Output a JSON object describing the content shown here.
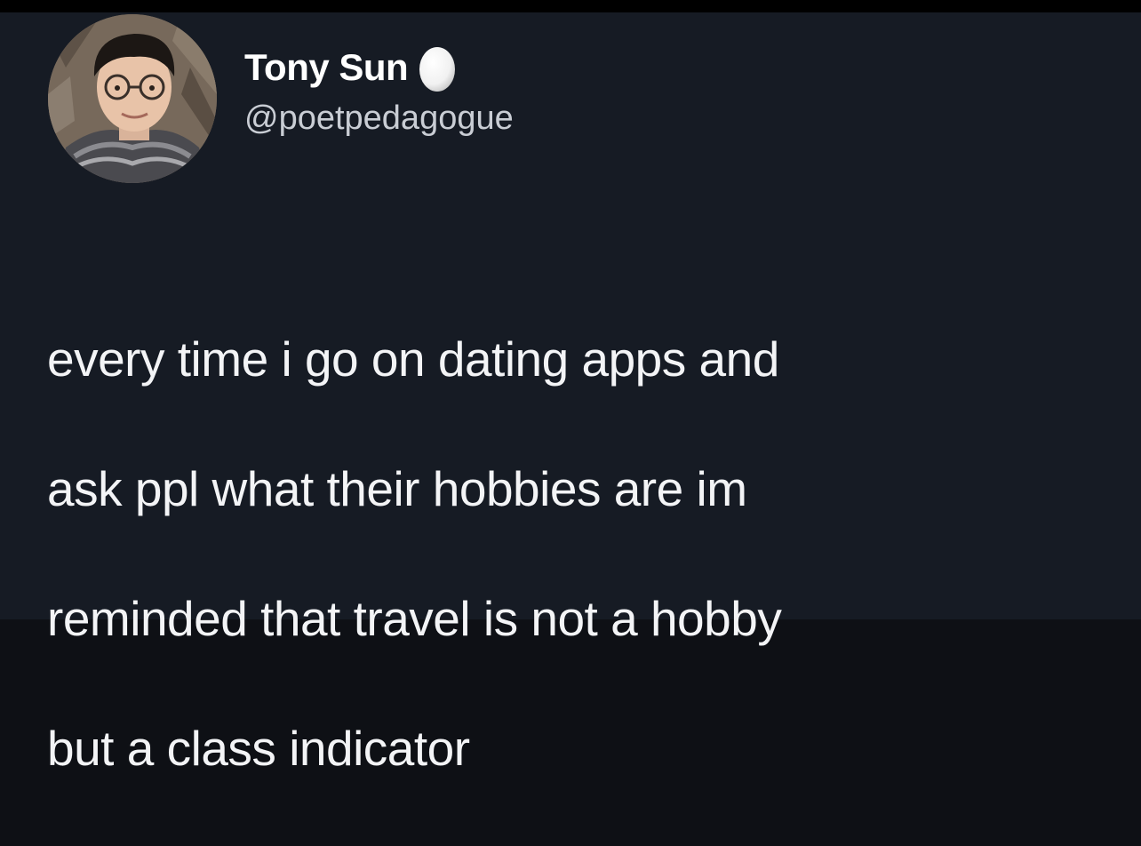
{
  "tweet": {
    "author": {
      "display_name": "Tony Sun",
      "handle": "@poetpedagogue",
      "avatar_icon": "profile-photo",
      "badge_icon": "egg-icon"
    },
    "text_lines": [
      "every time i go on dating apps and",
      "ask ppl what their hobbies are im",
      "reminded that travel is not a hobby",
      "but a class indicator"
    ]
  },
  "colors": {
    "background": "#161b24",
    "top_bar": "#000000",
    "name": "#ffffff",
    "handle": "#c9cdd4",
    "text": "#f3f4f6"
  }
}
